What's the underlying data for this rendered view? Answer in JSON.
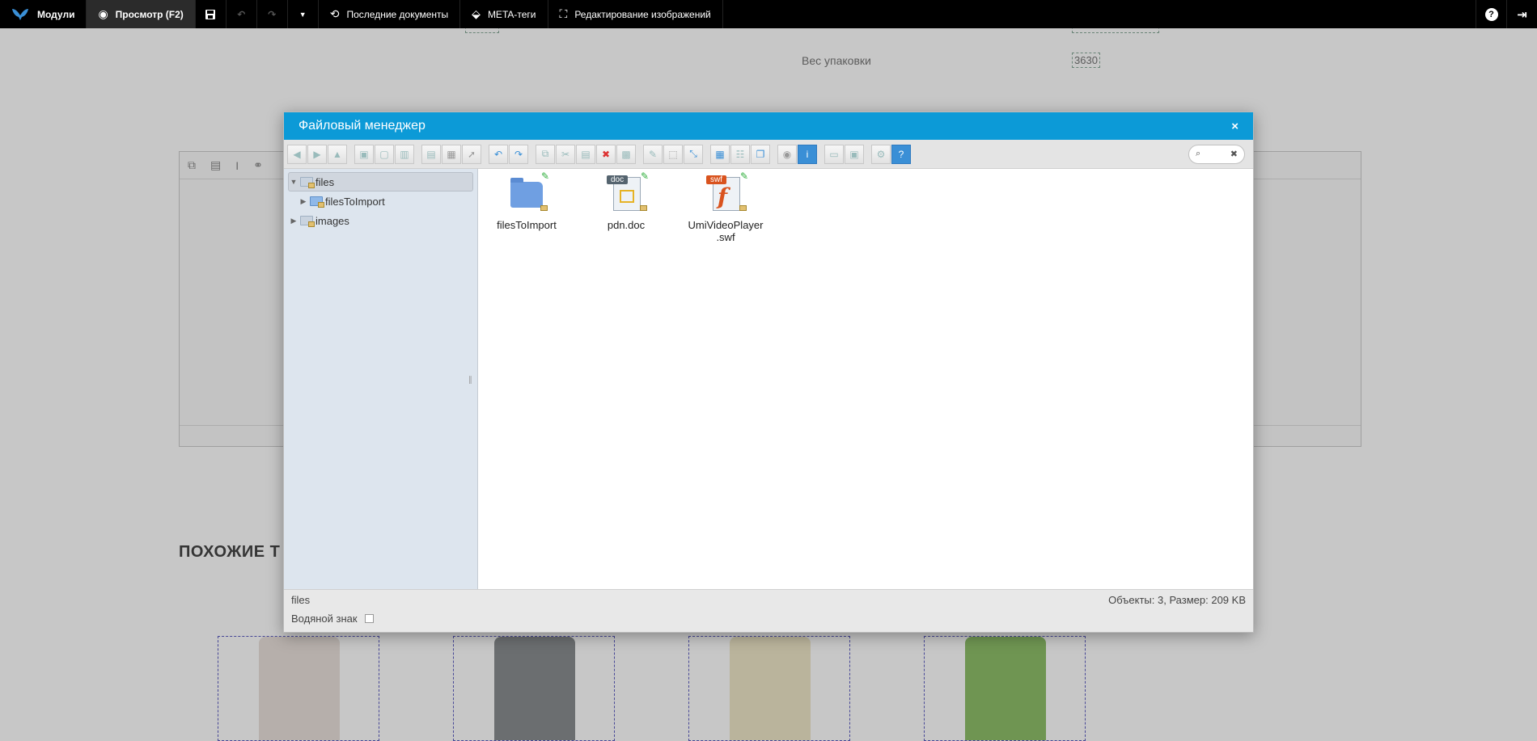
{
  "topbar": {
    "modules_label": "Модули",
    "preview_label": "Просмотр (F2)",
    "recent_docs_label": "Последние документы",
    "meta_tags_label": "META-теги",
    "image_edit_label": "Редактирование изображений",
    "help_label": "?"
  },
  "background": {
    "weight_label": "Вес упаковки",
    "weight_value": "3630",
    "heading": "ПОХОЖИЕ Т"
  },
  "modal": {
    "title": "Файловый менеджер",
    "close": "×",
    "search_icon": "⌕",
    "search_clear": "✖",
    "tree": [
      {
        "label": "files"
      },
      {
        "label": "filesToImport"
      },
      {
        "label": "images"
      }
    ],
    "files": [
      {
        "name": "filesToImport",
        "icon": "folder-icon"
      },
      {
        "name": "pdn.doc",
        "icon": "doc-icon",
        "badge": "doc"
      },
      {
        "name": "UmiVideoPlayer .swf",
        "icon": "swf-icon",
        "badge": "swf"
      }
    ],
    "status_path": "files",
    "status_info": "Объекты: 3, Размер: 209 KB",
    "watermark_label": "Водяной знак"
  }
}
